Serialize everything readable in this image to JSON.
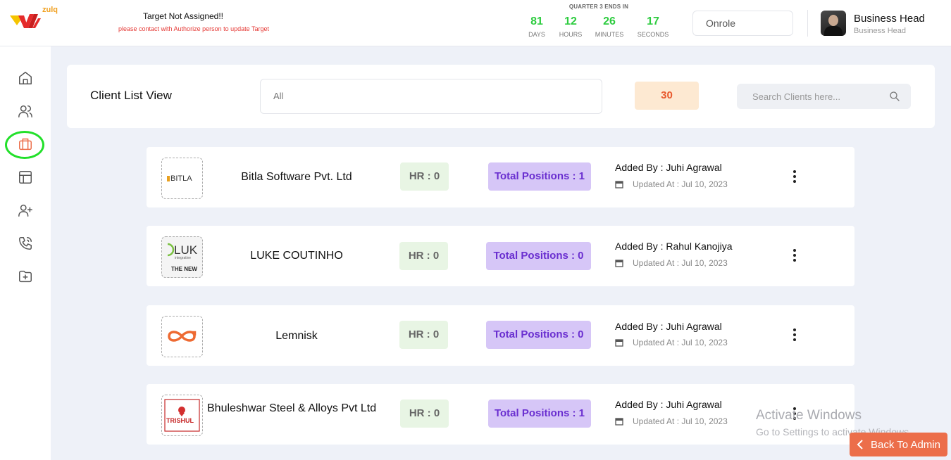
{
  "header": {
    "logo_text": "zulq",
    "target_title": "Target Not Assigned!!",
    "target_subtitle": "please contact with Authorize person to update Target",
    "quarter_label": "QUARTER 3 ENDS IN",
    "countdown": [
      {
        "value": "81",
        "label": "DAYS"
      },
      {
        "value": "12",
        "label": "HOURS"
      },
      {
        "value": "26",
        "label": "MINUTES"
      },
      {
        "value": "17",
        "label": "SECONDS"
      }
    ],
    "role_select_value": "Onrole",
    "user_name": "Business Head",
    "user_role": "Business Head"
  },
  "sidebar": {
    "items": [
      {
        "icon": "home-icon"
      },
      {
        "icon": "users-icon"
      },
      {
        "icon": "briefcase-icon",
        "active": true
      },
      {
        "icon": "layout-icon"
      },
      {
        "icon": "user-plus-icon"
      },
      {
        "icon": "phone-call-icon"
      },
      {
        "icon": "folder-plus-icon"
      }
    ]
  },
  "panel": {
    "title": "Client List View",
    "filter_value": "All",
    "count": "30",
    "search_placeholder": "Search Clients here..."
  },
  "clients": [
    {
      "name": "Bitla Software Pvt. Ltd",
      "logo_text": "BITLA",
      "hr": "HR : 0",
      "positions": "Total Positions : 1",
      "added_by": "Added By : Juhi Agrawal",
      "updated": "Updated At : Jul 10, 2023"
    },
    {
      "name": "LUKE COUTINHO",
      "logo_text": "LUK",
      "logo_sub": "integrative",
      "logo_sub2": "THE NEW",
      "hr": "HR : 0",
      "positions": "Total Positions : 0",
      "added_by": "Added By : Rahul Kanojiya",
      "updated": "Updated At : Jul 10, 2023"
    },
    {
      "name": "Lemnisk",
      "hr": "HR : 0",
      "positions": "Total Positions : 0",
      "added_by": "Added By : Juhi Agrawal",
      "updated": "Updated At : Jul 10, 2023"
    },
    {
      "name": "Bhuleshwar Steel & Alloys Pvt Ltd",
      "logo_text": "TRISHUL",
      "hr": "HR : 0",
      "positions": "Total Positions : 1",
      "added_by": "Added By : Juhi Agrawal",
      "updated": "Updated At : Jul 10, 2023"
    }
  ],
  "watermark": {
    "line1": "Activate Windows",
    "line2": "Go to Settings to activate Windows."
  },
  "back_button": "Back To Admin",
  "colors": {
    "accent_orange": "#ec6e4a",
    "countdown_green": "#2ecc40",
    "positions_purple": "#6a2fd0",
    "hr_badge_bg": "#e8f5e4",
    "count_badge_bg": "#fde9d2"
  }
}
